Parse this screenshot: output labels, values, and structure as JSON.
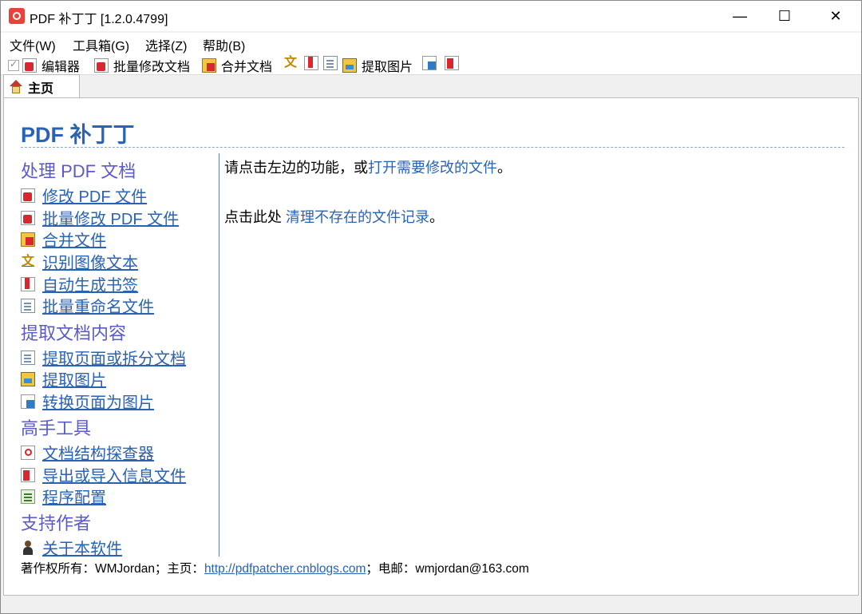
{
  "window": {
    "title": "PDF 补丁丁 [1.2.0.4799]",
    "minimize_glyph": "—",
    "maximize_glyph": "☐",
    "close_glyph": "✕"
  },
  "menubar": {
    "items": [
      "文件(W)",
      "工具箱(G)",
      "选择(Z)",
      "帮助(B)"
    ]
  },
  "toolbar": {
    "editor_label": "编辑器",
    "batch_label": "批量修改文档",
    "merge_label": "合并文档",
    "extract_images_label": "提取图片"
  },
  "tabs": [
    {
      "label": "主页",
      "icon": "home-icon"
    }
  ],
  "home": {
    "title": "PDF 补丁丁",
    "sections": [
      {
        "heading": "处理 PDF 文档",
        "links": [
          {
            "label": "修改 PDF 文件",
            "icon": "pdf-edit-icon"
          },
          {
            "label": "批量修改 PDF 文件",
            "icon": "pdf-batch-icon"
          },
          {
            "label": "合并文件",
            "icon": "merge-icon"
          },
          {
            "label": "识别图像文本",
            "icon": "ocr-icon"
          },
          {
            "label": "自动生成书签",
            "icon": "bookmark-icon"
          },
          {
            "label": "批量重命名文件",
            "icon": "rename-icon"
          }
        ]
      },
      {
        "heading": "提取文档内容",
        "links": [
          {
            "label": "提取页面或拆分文档",
            "icon": "extract-pages-icon"
          },
          {
            "label": "提取图片",
            "icon": "extract-images-icon"
          },
          {
            "label": "转换页面为图片",
            "icon": "convert-pages-icon"
          }
        ]
      },
      {
        "heading": "高手工具",
        "links": [
          {
            "label": "文档结构探查器",
            "icon": "structure-explorer-icon"
          },
          {
            "label": "导出或导入信息文件",
            "icon": "export-import-icon"
          },
          {
            "label": "程序配置",
            "icon": "settings-icon"
          }
        ]
      },
      {
        "heading": "支持作者",
        "links": [
          {
            "label": "关于本软件",
            "icon": "about-icon"
          }
        ]
      }
    ],
    "message1_prefix": "请点击左边的功能，或",
    "message1_link": "打开需要修改的文件",
    "message1_suffix": "。",
    "message2_prefix": "点击此处 ",
    "message2_link": "清理不存在的文件记录",
    "message2_suffix": "。",
    "footer": {
      "prefix": "著作权所有：WMJordan；主页：",
      "url": "http://pdfpatcher.cnblogs.com",
      "suffix": "；电邮：wmjordan@163.com"
    }
  }
}
